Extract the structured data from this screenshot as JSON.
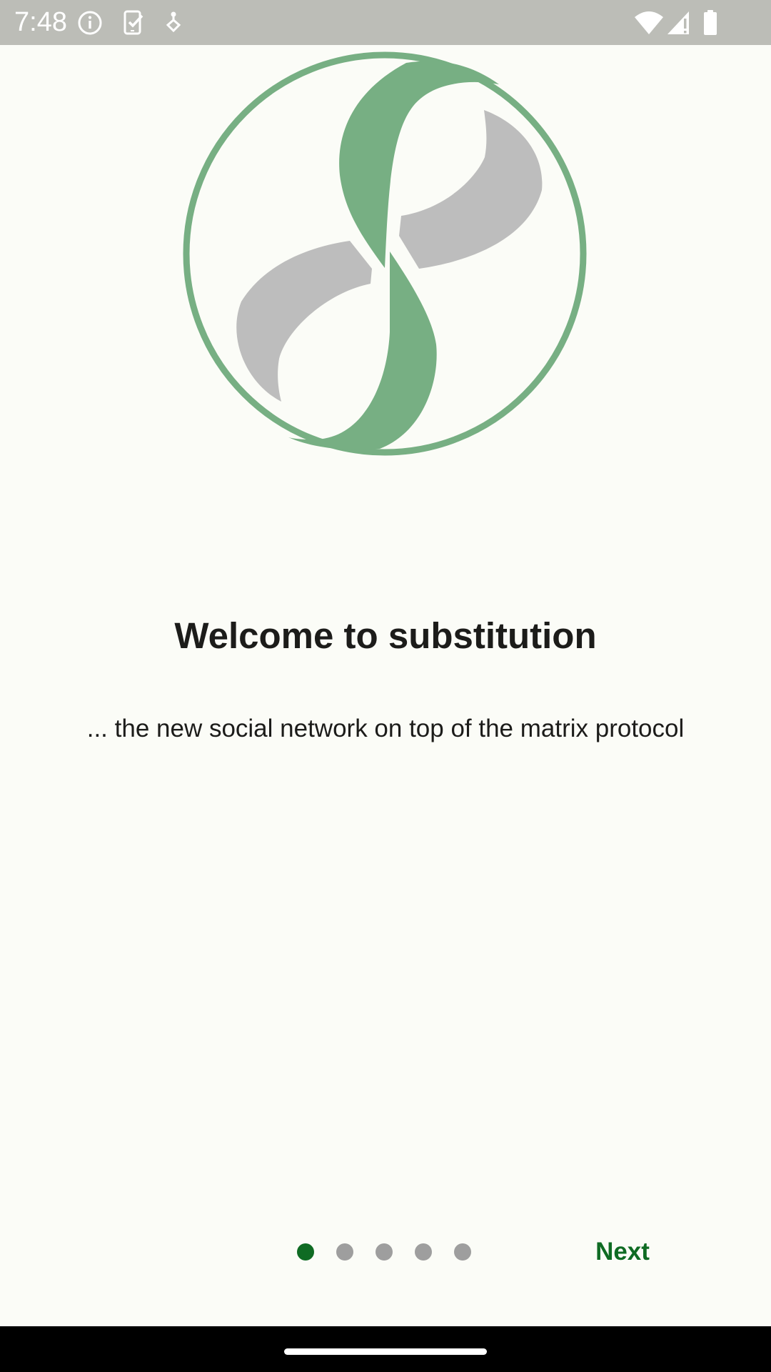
{
  "status_bar": {
    "time": "7:48",
    "icons": [
      "info-icon",
      "task-icon",
      "location-icon",
      "wifi-icon",
      "signal-icon",
      "battery-icon"
    ]
  },
  "onboarding": {
    "title": "Welcome to substitution",
    "subtitle": "... the new social network on top of the matrix protocol",
    "page_count": 5,
    "current_page": 1,
    "next_label": "Next"
  },
  "colors": {
    "background": "#fbfcf7",
    "accent": "#0f6b23",
    "logo_green": "#77af83",
    "logo_gray": "#bdbdbd",
    "dot_inactive": "#9e9e9e"
  }
}
